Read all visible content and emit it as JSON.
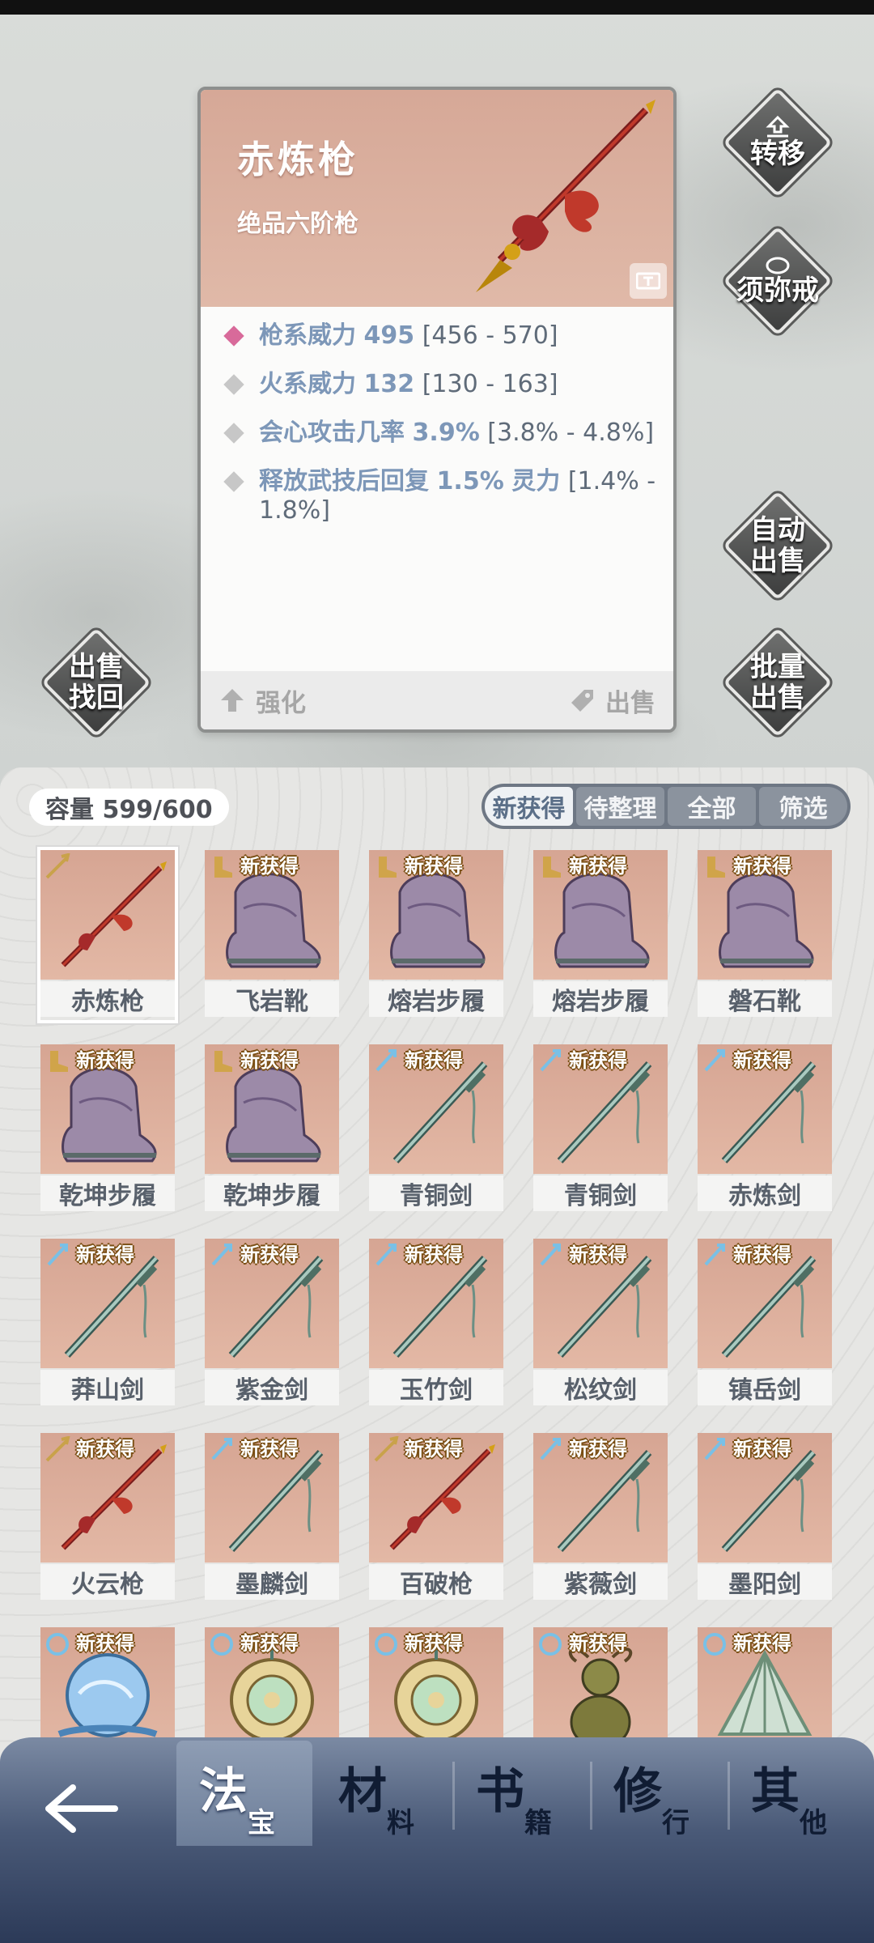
{
  "detail": {
    "title": "赤炼枪",
    "subtitle": "绝品六阶枪",
    "attributes": [
      {
        "label": "枪系威力",
        "value": "495",
        "range": "[456 - 570]",
        "highlight": true
      },
      {
        "label": "火系威力",
        "value": "132",
        "range": "[130 - 163]",
        "highlight": false
      },
      {
        "label": "会心攻击几率",
        "value": "3.9%",
        "range": "[3.8% - 4.8%]",
        "highlight": false
      },
      {
        "label": "释放武技后回复",
        "value": "1.5%",
        "suffix": "灵力",
        "range": "[1.4% - 1.8%]",
        "highlight": false
      }
    ],
    "enhance_label": "强化",
    "sell_label": "出售"
  },
  "side_buttons": {
    "transfer": "转移",
    "ring": "须弥戒",
    "auto_sell": [
      "自动",
      "出售"
    ],
    "batch_sell": [
      "批量",
      "出售"
    ],
    "buyback": [
      "出售",
      "找回"
    ]
  },
  "inventory": {
    "capacity": "容量 599/600",
    "filters": [
      "新获得",
      "待整理",
      "全部",
      "筛选"
    ],
    "new_badge": "新获得",
    "items": [
      {
        "name": "赤炼枪",
        "type": "spear",
        "new": false
      },
      {
        "name": "飞岩靴",
        "type": "boot",
        "new": true
      },
      {
        "name": "熔岩步履",
        "type": "boot",
        "new": true
      },
      {
        "name": "熔岩步履",
        "type": "boot",
        "new": true
      },
      {
        "name": "磐石靴",
        "type": "boot",
        "new": true
      },
      {
        "name": "乾坤步履",
        "type": "boot",
        "new": true
      },
      {
        "name": "乾坤步履",
        "type": "boot",
        "new": true
      },
      {
        "name": "青铜剑",
        "type": "sword",
        "new": true
      },
      {
        "name": "青铜剑",
        "type": "sword",
        "new": true
      },
      {
        "name": "赤炼剑",
        "type": "sword",
        "new": true
      },
      {
        "name": "莽山剑",
        "type": "sword",
        "new": true
      },
      {
        "name": "紫金剑",
        "type": "sword",
        "new": true
      },
      {
        "name": "玉竹剑",
        "type": "sword",
        "new": true
      },
      {
        "name": "松纹剑",
        "type": "sword",
        "new": true
      },
      {
        "name": "镇岳剑",
        "type": "sword",
        "new": true
      },
      {
        "name": "火云枪",
        "type": "spear",
        "new": true
      },
      {
        "name": "墨麟剑",
        "type": "sword",
        "new": true
      },
      {
        "name": "百破枪",
        "type": "spear",
        "new": true
      },
      {
        "name": "紫薇剑",
        "type": "sword",
        "new": true
      },
      {
        "name": "墨阳剑",
        "type": "sword",
        "new": true
      },
      {
        "name": "",
        "type": "orb",
        "new": true
      },
      {
        "name": "",
        "type": "jade",
        "new": true
      },
      {
        "name": "",
        "type": "jade",
        "new": true
      },
      {
        "name": "",
        "type": "gourd",
        "new": true
      },
      {
        "name": "",
        "type": "fan",
        "new": true
      }
    ]
  },
  "nav": {
    "tabs": [
      {
        "big": "法",
        "small": "宝"
      },
      {
        "big": "材",
        "small": "料"
      },
      {
        "big": "书",
        "small": "籍"
      },
      {
        "big": "修",
        "small": "行"
      },
      {
        "big": "其",
        "small": "他"
      }
    ]
  }
}
